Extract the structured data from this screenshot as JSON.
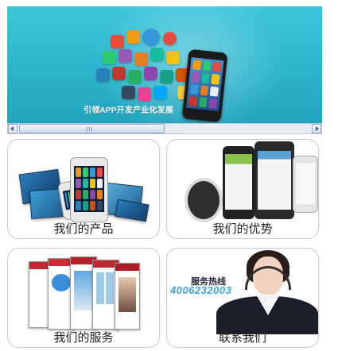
{
  "banner": {
    "tagline": "引领APP开发产业化发展"
  },
  "cards": [
    {
      "label": "我们的产品"
    },
    {
      "label": "我们的优势"
    },
    {
      "label": "我们的服务"
    },
    {
      "label": "联系我们"
    }
  ],
  "contact": {
    "hotline_title": "服务热线",
    "hotline_number": "4006232003"
  },
  "colors": {
    "banner_bg": "#2bb4cc",
    "hotline_number": "#3ea0df",
    "card_border": "#c9c9c9"
  }
}
